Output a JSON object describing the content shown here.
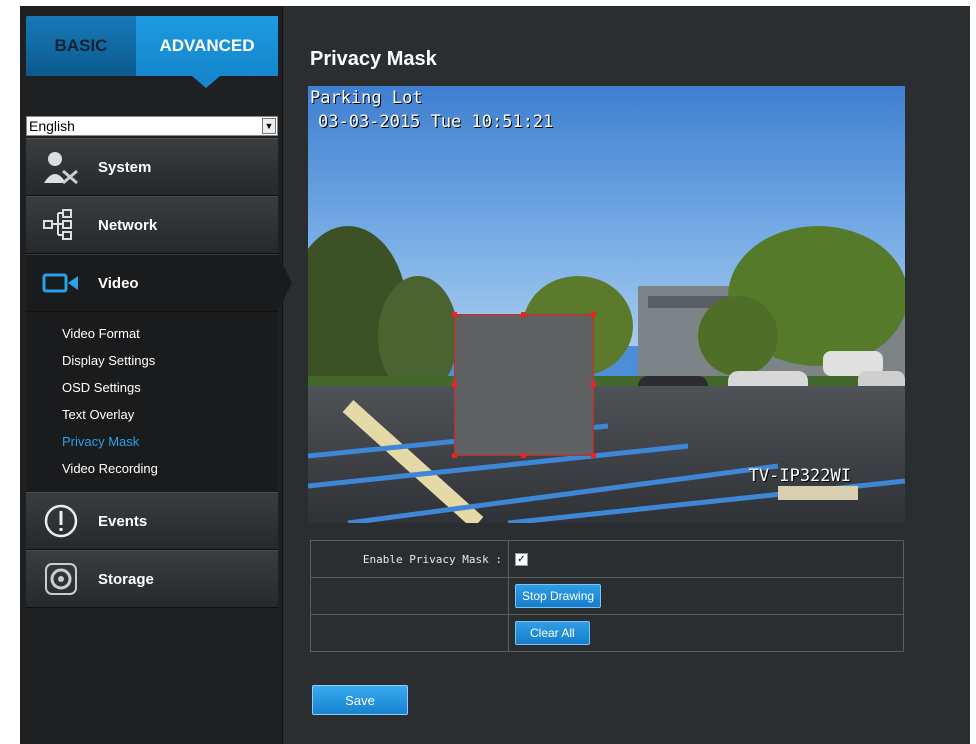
{
  "tabs": {
    "basic": "BASIC",
    "advanced": "ADVANCED"
  },
  "language": {
    "selected": "English"
  },
  "nav": {
    "system": "System",
    "network": "Network",
    "video": "Video",
    "events": "Events",
    "storage": "Storage"
  },
  "video_submenu": [
    "Video Format",
    "Display Settings",
    "OSD Settings",
    "Text Overlay",
    "Privacy Mask",
    "Video Recording"
  ],
  "active_submenu": "Privacy Mask",
  "page": {
    "title": "Privacy Mask",
    "osd_name": "Parking Lot",
    "osd_datetime": "03-03-2015 Tue 10:51:21",
    "osd_model": "TV-IP322WI"
  },
  "settings": {
    "enable_label": "Enable Privacy Mask :",
    "enable_checked": true,
    "stop_drawing": "Stop Drawing",
    "clear_all": "Clear All"
  },
  "save_label": "Save",
  "colors": {
    "accent": "#1587cd",
    "active_link": "#2aa1ea",
    "mask_border": "#dd2222"
  }
}
